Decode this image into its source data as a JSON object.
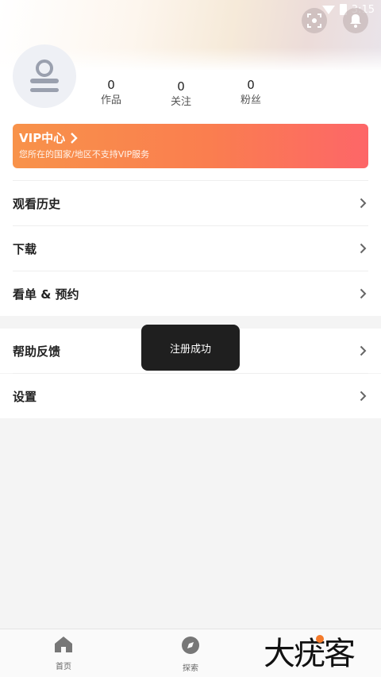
{
  "status": {
    "time": "3:15"
  },
  "profile": {
    "stats": [
      {
        "value": "0",
        "label": "作品"
      },
      {
        "value": "0",
        "label": "关注"
      },
      {
        "value": "0",
        "label": "粉丝"
      }
    ]
  },
  "vip": {
    "title": "VIP中心",
    "subtitle": "您所在的国家/地区不支持VIP服务"
  },
  "menu": {
    "group1": [
      {
        "label": "观看历史"
      },
      {
        "label": "下载"
      },
      {
        "label": "看单 & 预约"
      }
    ],
    "group2": [
      {
        "label": "帮助反馈"
      },
      {
        "label": "设置"
      }
    ]
  },
  "toast": {
    "text": "注册成功"
  },
  "bottom_nav": [
    {
      "label": "首页"
    },
    {
      "label": "探索"
    }
  ],
  "watermark": {
    "text": "大疣客"
  },
  "colors": {
    "vip_start": "#f8924a",
    "vip_end": "#fd6668",
    "toast_bg": "#1f1f1f",
    "watermark_dot": "#f47a2a"
  }
}
